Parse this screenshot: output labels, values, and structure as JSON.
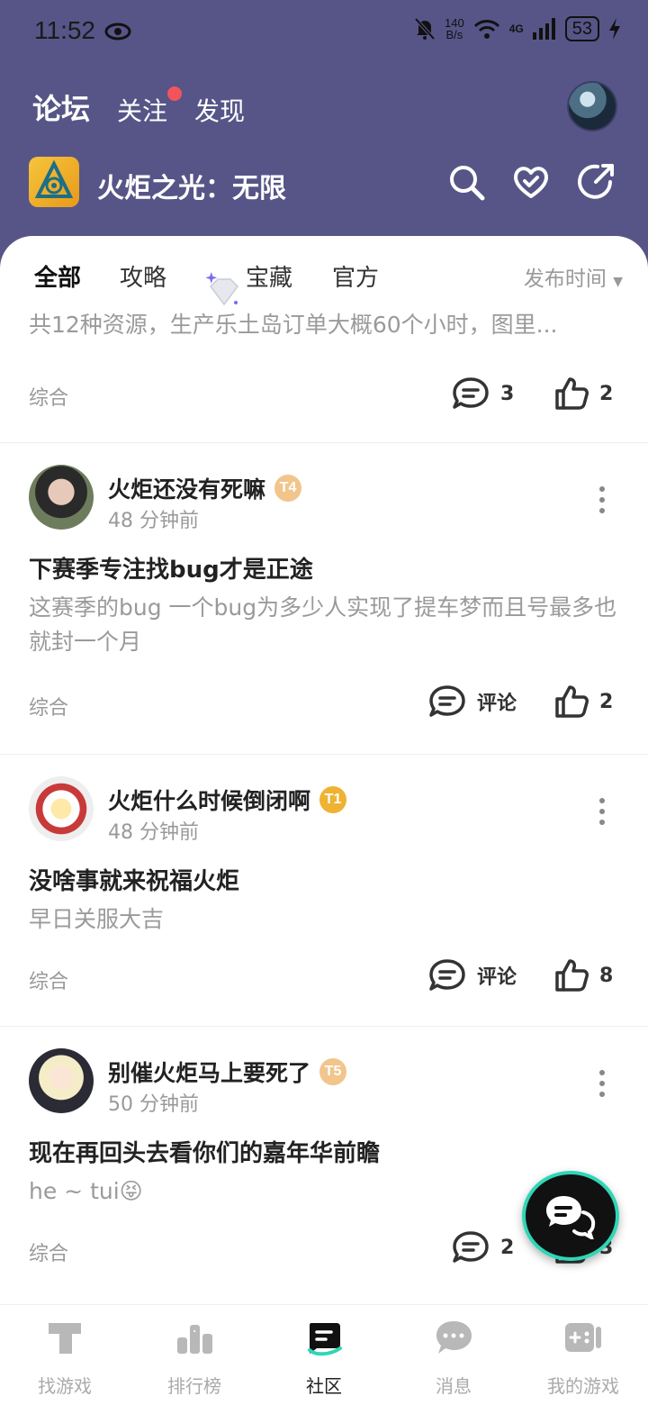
{
  "status_bar": {
    "time": "11:52",
    "net_speed_value": "140",
    "net_speed_unit": "B/s",
    "network": "4G",
    "battery": "53"
  },
  "top_tabs": [
    {
      "label": "论坛",
      "active": true
    },
    {
      "label": "关注",
      "has_dot": true
    },
    {
      "label": "发现"
    }
  ],
  "game": {
    "name": "火炬之光：无限"
  },
  "filter_tabs": [
    {
      "label": "全部",
      "active": true
    },
    {
      "label": "攻略"
    },
    {
      "label": "宝藏",
      "icon": "diamond-icon"
    },
    {
      "label": "官方"
    }
  ],
  "sort": {
    "label": "发布时间"
  },
  "partial_post": {
    "body": "共12种资源，生产乐土岛订单大概60个小时，图里...",
    "category": "综合",
    "comments": "3",
    "likes": "2"
  },
  "posts": [
    {
      "username": "火炬还没有死嘛",
      "badge": "T4",
      "time": "48 分钟前",
      "title": "下赛季专注找bug才是正途",
      "body": "这赛季的bug 一个bug为多少人实现了提车梦而且号最多也就封一个月",
      "category": "综合",
      "comments": "评论",
      "likes": "2"
    },
    {
      "username": "火炬什么时候倒闭啊",
      "badge": "T1",
      "time": "48 分钟前",
      "title": "没啥事就来祝福火炬",
      "body": "早日关服大吉",
      "category": "综合",
      "comments": "评论",
      "likes": "8"
    },
    {
      "username": "别催火炬马上要死了",
      "badge": "T5",
      "time": "50 分钟前",
      "title": "现在再回头去看你们的嘉年华前瞻",
      "body": "he ~ tui😝",
      "category": "综合",
      "comments": "2",
      "likes": "3"
    }
  ],
  "bottom_nav": [
    {
      "label": "找游戏",
      "icon": "find-game-icon"
    },
    {
      "label": "排行榜",
      "icon": "ranking-icon"
    },
    {
      "label": "社区",
      "icon": "community-icon",
      "active": true
    },
    {
      "label": "消息",
      "icon": "message-icon"
    },
    {
      "label": "我的游戏",
      "icon": "my-games-icon"
    }
  ],
  "colors": {
    "header_bg": "#575587",
    "accent": "#2fd6b8",
    "notification_dot": "#f2545b"
  }
}
